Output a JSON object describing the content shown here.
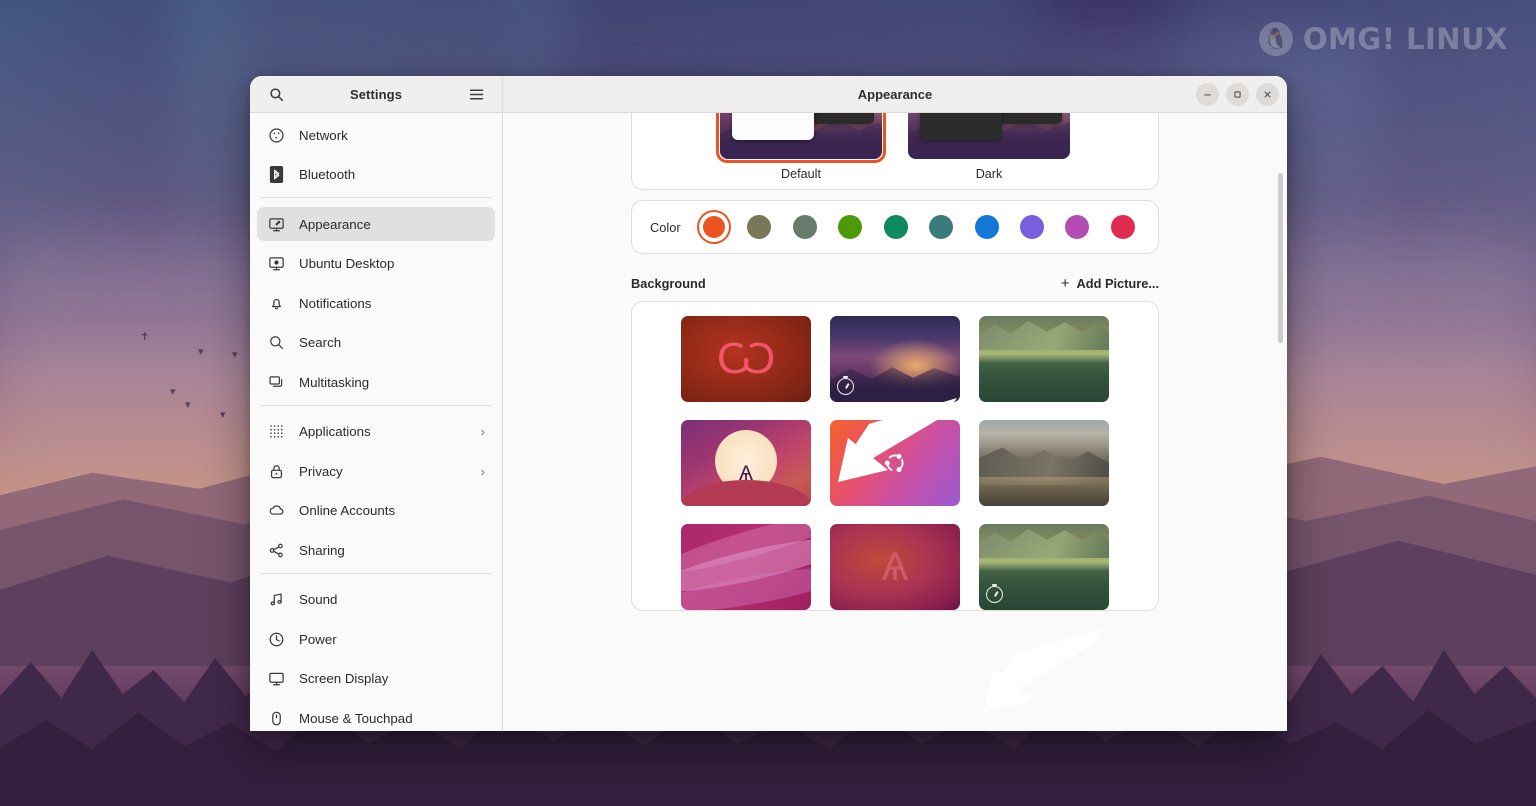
{
  "watermark": {
    "text": "OMG! LINUX",
    "logo_icon": "penguin-icon"
  },
  "window": {
    "app_title": "Settings",
    "pane_title": "Appearance",
    "search_icon": "search-icon",
    "menu_icon": "hamburger-menu-icon",
    "controls": {
      "minimize": "minimize-icon",
      "maximize": "maximize-icon",
      "close": "close-icon"
    }
  },
  "sidebar": {
    "groups": [
      {
        "items": [
          {
            "label": "Network",
            "icon": "network-icon",
            "active": false,
            "chevron": ""
          },
          {
            "label": "Bluetooth",
            "icon": "bluetooth-icon",
            "active": false,
            "chevron": ""
          }
        ]
      },
      {
        "items": [
          {
            "label": "Appearance",
            "icon": "appearance-icon",
            "active": true,
            "chevron": ""
          },
          {
            "label": "Ubuntu Desktop",
            "icon": "ubuntu-desktop-icon",
            "active": false,
            "chevron": ""
          },
          {
            "label": "Notifications",
            "icon": "bell-icon",
            "active": false,
            "chevron": ""
          },
          {
            "label": "Search",
            "icon": "search-icon",
            "active": false,
            "chevron": ""
          },
          {
            "label": "Multitasking",
            "icon": "multitasking-icon",
            "active": false,
            "chevron": ""
          }
        ]
      },
      {
        "items": [
          {
            "label": "Applications",
            "icon": "grid-apps-icon",
            "active": false,
            "chevron": "›"
          },
          {
            "label": "Privacy",
            "icon": "lock-icon",
            "active": false,
            "chevron": "›"
          },
          {
            "label": "Online Accounts",
            "icon": "cloud-icon",
            "active": false,
            "chevron": ""
          },
          {
            "label": "Sharing",
            "icon": "share-nodes-icon",
            "active": false,
            "chevron": ""
          }
        ]
      },
      {
        "items": [
          {
            "label": "Sound",
            "icon": "music-note-icon",
            "active": false,
            "chevron": ""
          },
          {
            "label": "Power",
            "icon": "power-icon",
            "active": false,
            "chevron": ""
          },
          {
            "label": "Screen Display",
            "icon": "monitor-icon",
            "active": false,
            "chevron": ""
          },
          {
            "label": "Mouse & Touchpad",
            "icon": "mouse-icon",
            "active": false,
            "chevron": ""
          }
        ]
      }
    ]
  },
  "appearance": {
    "styles": [
      {
        "name": "Default",
        "selected": true
      },
      {
        "name": "Dark",
        "selected": false
      }
    ],
    "color_label": "Color",
    "colors": [
      {
        "name": "orange",
        "hex": "#e95420",
        "selected": true
      },
      {
        "name": "olive",
        "hex": "#787859",
        "selected": false
      },
      {
        "name": "sage",
        "hex": "#657b6b",
        "selected": false
      },
      {
        "name": "green",
        "hex": "#4e9a06",
        "selected": false
      },
      {
        "name": "emerald",
        "hex": "#0e8a5f",
        "selected": false
      },
      {
        "name": "teal",
        "hex": "#3a7b7b",
        "selected": false
      },
      {
        "name": "blue",
        "hex": "#1277d6",
        "selected": false
      },
      {
        "name": "purple",
        "hex": "#7a5ee0",
        "selected": false
      },
      {
        "name": "magenta",
        "hex": "#b34cb3",
        "selected": false
      },
      {
        "name": "red",
        "hex": "#e02b4f",
        "selected": false
      }
    ]
  },
  "background": {
    "title": "Background",
    "add_picture_label": "Add Picture...",
    "add_picture_icon": "plus-icon",
    "wallpapers": [
      {
        "name": "kudu-red",
        "art": "w-kudu-red",
        "timer": false
      },
      {
        "name": "aurora-valley",
        "art": "w-aurora",
        "timer": true
      },
      {
        "name": "green-lake",
        "art": "w-lake",
        "timer": false
      },
      {
        "name": "sunset-kudu",
        "art": "w-sunset-kudu",
        "timer": false
      },
      {
        "name": "ubuntu-logo",
        "art": "w-ubuntu-grad",
        "timer": false
      },
      {
        "name": "fjord-dunes",
        "art": "w-fjord",
        "timer": false
      },
      {
        "name": "pink-waves",
        "art": "w-waves",
        "timer": false
      },
      {
        "name": "leaping-kudu",
        "art": "w-leaping",
        "timer": false
      },
      {
        "name": "green-lake-2",
        "art": "w-lake",
        "timer": true
      }
    ]
  },
  "annotations": [
    {
      "name": "arrow-to-timer-badge-aurora",
      "target": "aurora-valley"
    },
    {
      "name": "arrow-to-timer-badge-lake",
      "target": "green-lake-2"
    }
  ]
}
